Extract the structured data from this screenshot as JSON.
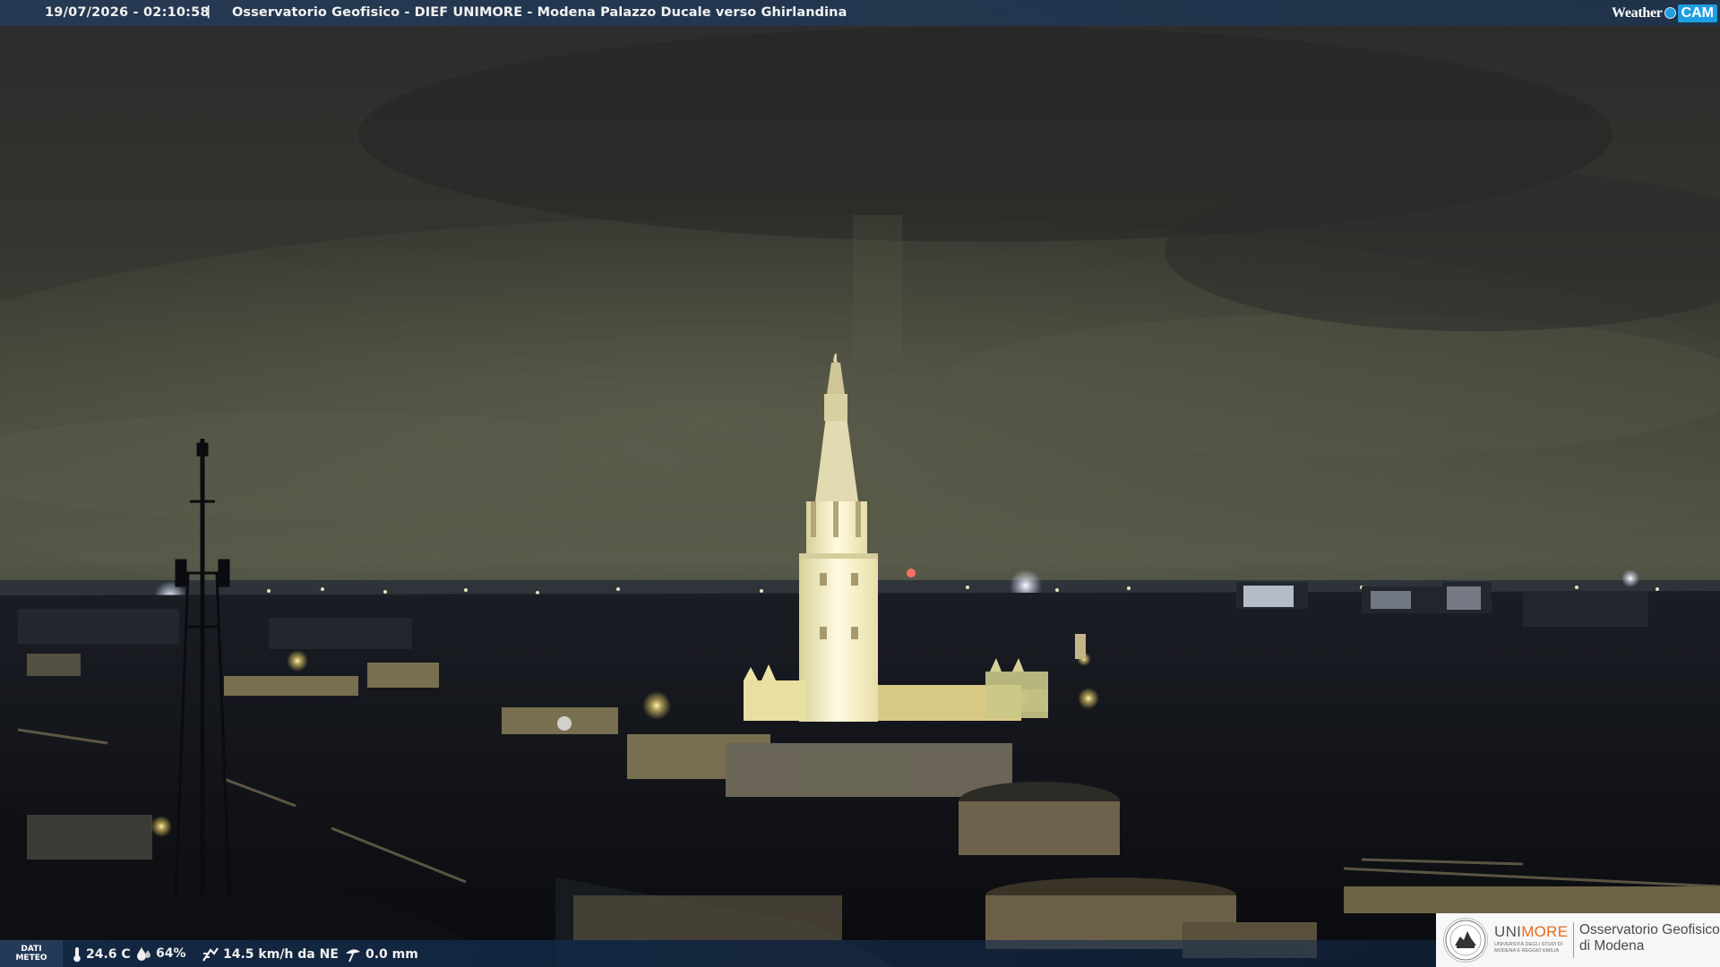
{
  "overlay": {
    "datetime": "19/07/2026 - 02:10:58",
    "separator": "|",
    "caption": "Osservatorio Geofisico - DIEF UNIMORE - Modena Palazzo Ducale verso Ghirlandina"
  },
  "brand": {
    "weather_text": "Weather",
    "cam_text": "CAM",
    "accent": "#1e9ee0"
  },
  "meteo": {
    "label_line1": "DATI",
    "label_line2": "METEO",
    "temperature": "24.6 C",
    "humidity": "64%",
    "wind": "14.5 km/h da NE",
    "rain": "0.0 mm",
    "icons": [
      "thermometer-icon",
      "humidity-drop-icon",
      "wind-icon",
      "rain-gauge-icon"
    ]
  },
  "logo": {
    "name_part1": "UNI",
    "name_part2": "MORE",
    "subtitle": "UNIVERSITÀ DEGLI STUDI DI MODENA E REGGIO EMILIA",
    "observatory_line1": "Osservatorio Geofisico",
    "observatory_line2": "di Modena",
    "accent": "#e86a1d"
  }
}
